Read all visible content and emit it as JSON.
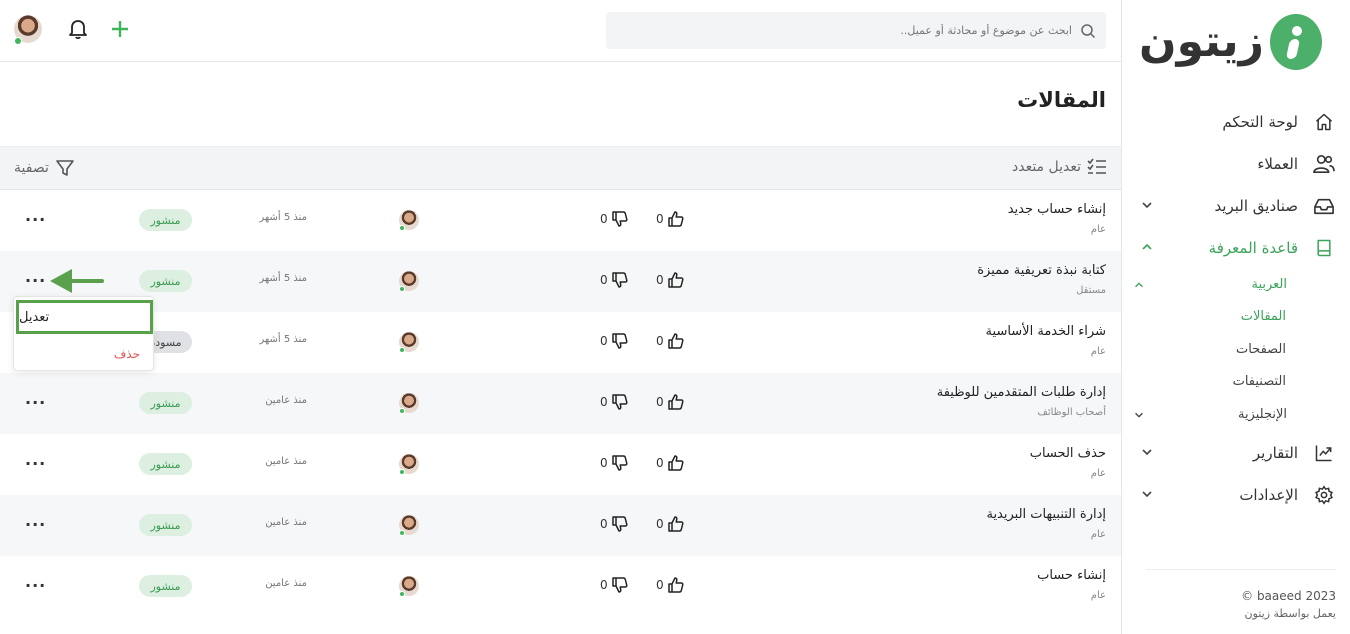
{
  "brand": {
    "name": "زيتون",
    "accent": "#4caf6a"
  },
  "search": {
    "placeholder": "ابحث عن موضوع أو محادثة أو عميل.."
  },
  "sidebar": {
    "items": [
      {
        "label": "لوحة التحكم",
        "icon": "home-icon"
      },
      {
        "label": "العملاء",
        "icon": "users-icon"
      },
      {
        "label": "صناديق البريد",
        "icon": "inbox-icon"
      },
      {
        "label": "قاعدة المعرفة",
        "icon": "book-icon"
      },
      {
        "label": "التقارير",
        "icon": "chart-icon"
      },
      {
        "label": "الإعدادات",
        "icon": "gear-icon"
      }
    ],
    "sub": {
      "arabic": "العربية",
      "articles": "المقالات",
      "pages": "الصفحات",
      "categories": "التصنيفات",
      "english": "الإنجليزية"
    },
    "footer": {
      "copyright": "© baaeed 2023",
      "powered": "يعمل بواسطة زيتون"
    }
  },
  "page": {
    "title": "المقالات"
  },
  "toolbar": {
    "bulk_edit": "تعديل متعدد",
    "filter": "تصفية"
  },
  "rows": [
    {
      "title": "إنشاء حساب جديد",
      "category": "عام",
      "likes": "0",
      "dislikes": "0",
      "date": "منذ 5 أشهر",
      "status": "منشور",
      "draft": false
    },
    {
      "title": "كتابة نبذة تعريفية مميزة",
      "category": "مستقل",
      "likes": "0",
      "dislikes": "0",
      "date": "منذ 5 أشهر",
      "status": "منشور",
      "draft": false
    },
    {
      "title": "شراء الخدمة الأساسية",
      "category": "عام",
      "likes": "0",
      "dislikes": "0",
      "date": "منذ 5 أشهر",
      "status": "مسودة",
      "draft": true
    },
    {
      "title": "إدارة طلبات المتقدمين للوظيفة",
      "category": "أصحاب الوظائف",
      "likes": "0",
      "dislikes": "0",
      "date": "منذ عامين",
      "status": "منشور",
      "draft": false
    },
    {
      "title": "حذف الحساب",
      "category": "عام",
      "likes": "0",
      "dislikes": "0",
      "date": "منذ عامين",
      "status": "منشور",
      "draft": false
    },
    {
      "title": "إدارة التنبيهات البريدية",
      "category": "عام",
      "likes": "0",
      "dislikes": "0",
      "date": "منذ عامين",
      "status": "منشور",
      "draft": false
    },
    {
      "title": "إنشاء حساب",
      "category": "عام",
      "likes": "0",
      "dislikes": "0",
      "date": "منذ عامين",
      "status": "منشور",
      "draft": false
    }
  ],
  "menu": {
    "edit": "تعديل",
    "delete": "حذف"
  }
}
